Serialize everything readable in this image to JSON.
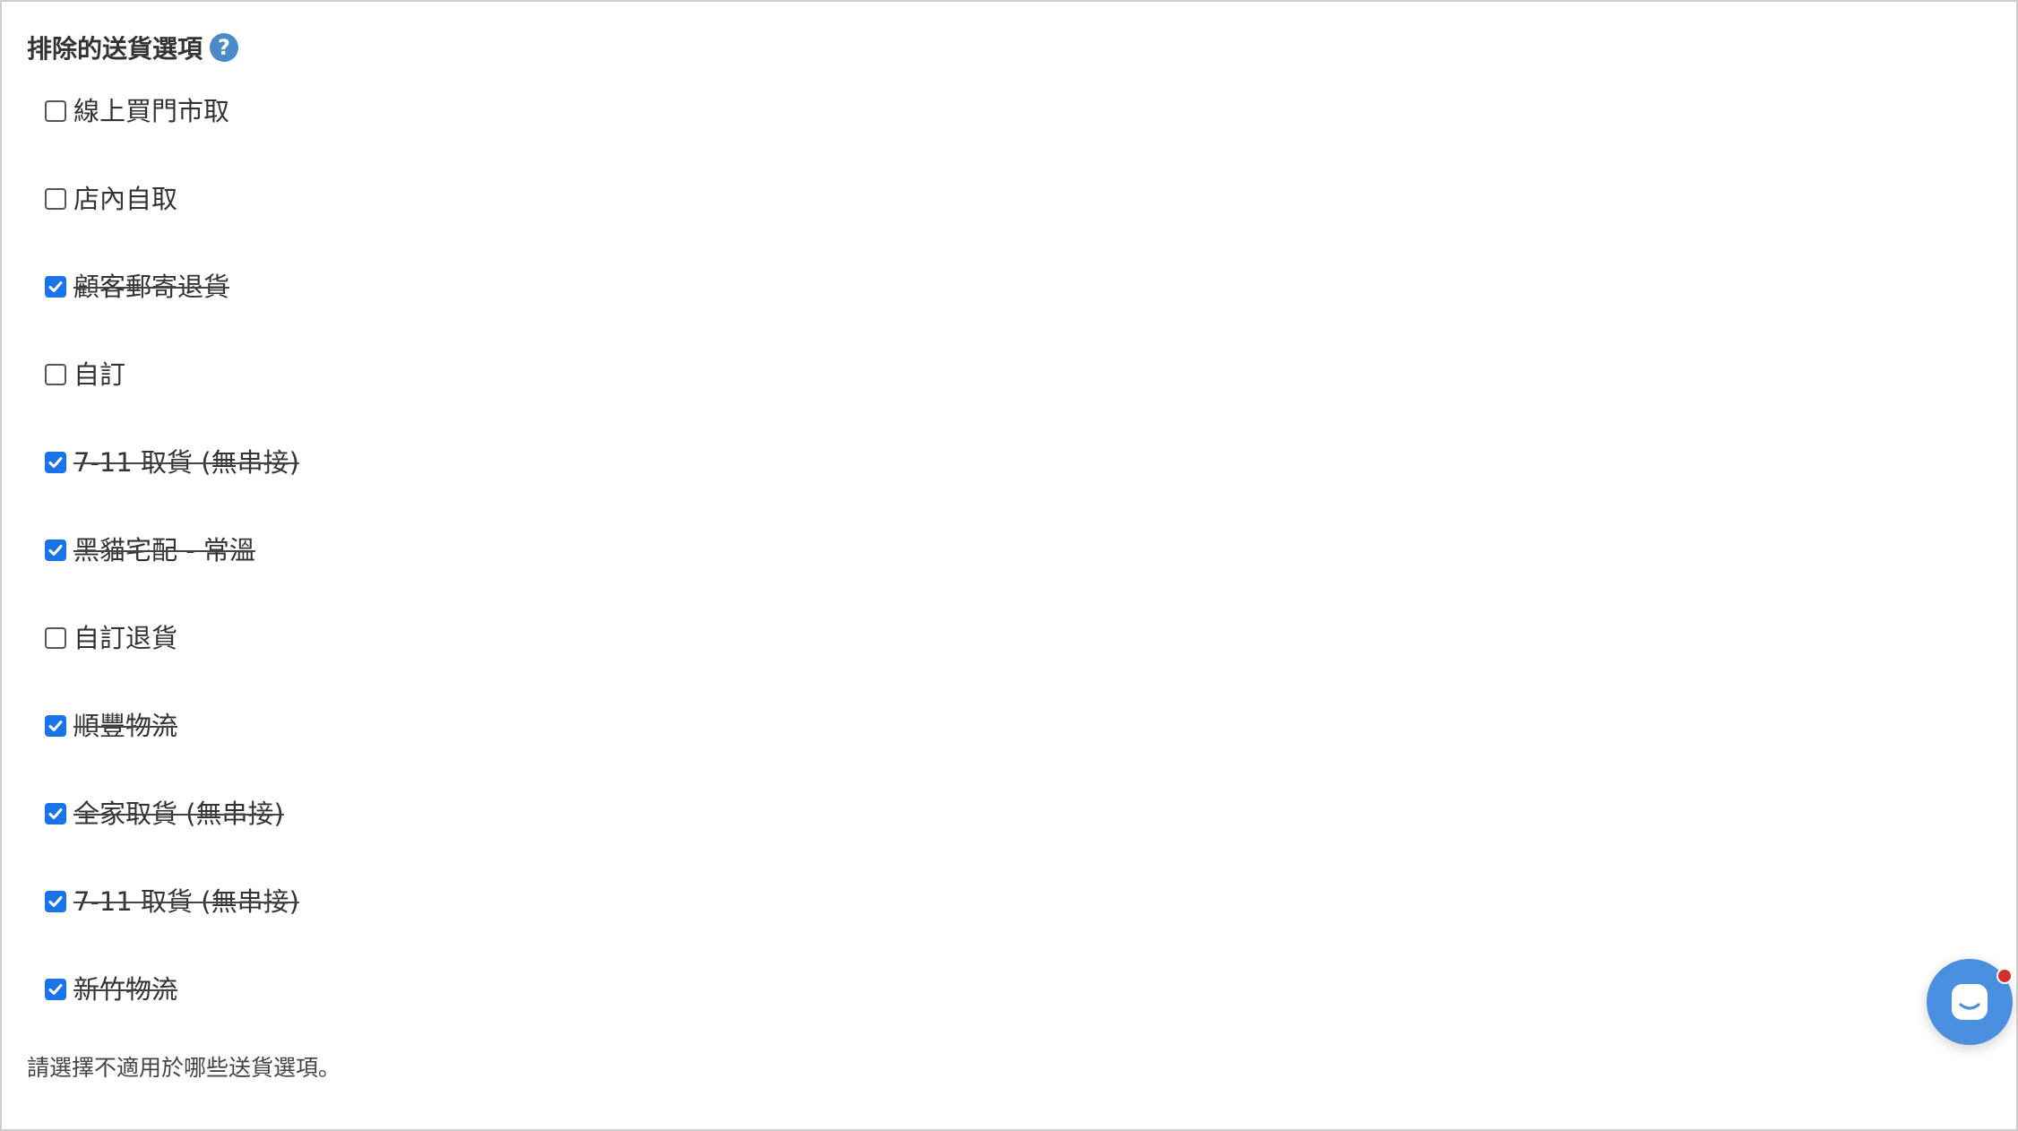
{
  "section": {
    "title": "排除的送貨選項",
    "help_glyph": "?"
  },
  "options": [
    {
      "label": "線上買門市取",
      "checked": false
    },
    {
      "label": "店內自取",
      "checked": false
    },
    {
      "label": "顧客郵寄退貨",
      "checked": true
    },
    {
      "label": "自訂",
      "checked": false
    },
    {
      "label": "7-11 取貨 (無串接)",
      "checked": true
    },
    {
      "label": "黑貓宅配 - 常溫",
      "checked": true
    },
    {
      "label": "自訂退貨",
      "checked": false
    },
    {
      "label": "順豐物流",
      "checked": true
    },
    {
      "label": "全家取貨 (無串接)",
      "checked": true
    },
    {
      "label": "7-11 取貨 (無串接)",
      "checked": true
    },
    {
      "label": "新竹物流",
      "checked": true
    }
  ],
  "hint": "請選擇不適用於哪些送貨選項。",
  "colors": {
    "checkbox_checked": "#1a73e8",
    "help_icon": "#4a8ac9",
    "chat_launcher": "#4a8fe0",
    "notification_dot": "#d32f2f"
  },
  "icons": {
    "help": "question-circle-icon",
    "chat": "chat-bubble-icon",
    "check": "checkmark-icon"
  }
}
